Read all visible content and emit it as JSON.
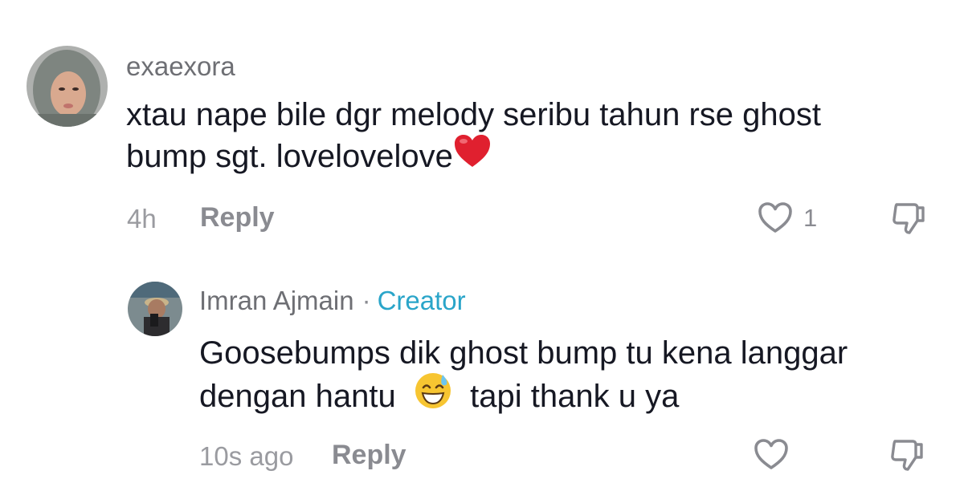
{
  "comments": [
    {
      "username": "exaexora",
      "text_lines": [
        "xtau nape bile dgr melody seribu tahun rse ghost",
        "bump sgt. lovelovelove"
      ],
      "emoji": "heart-emoji",
      "time": "4h",
      "reply_label": "Reply",
      "like_count": "1",
      "icons": {
        "like": "heart-outline-icon",
        "dislike": "thumbs-down-icon"
      }
    },
    {
      "username": "Imran Ajmain",
      "separator": "·",
      "badge": "Creator",
      "text_lines": [
        "Goosebumps dik ghost bump tu kena langgar",
        "dengan hantu",
        "tapi thank u ya"
      ],
      "emoji": "grinning-sweat-emoji",
      "time": "10s ago",
      "reply_label": "Reply",
      "icons": {
        "like": "heart-outline-icon",
        "dislike": "thumbs-down-icon"
      }
    }
  ],
  "colors": {
    "text": "#161823",
    "meta": "#8a8b91",
    "creator": "#2aa5c9",
    "heart_emoji": "#e0202f"
  }
}
